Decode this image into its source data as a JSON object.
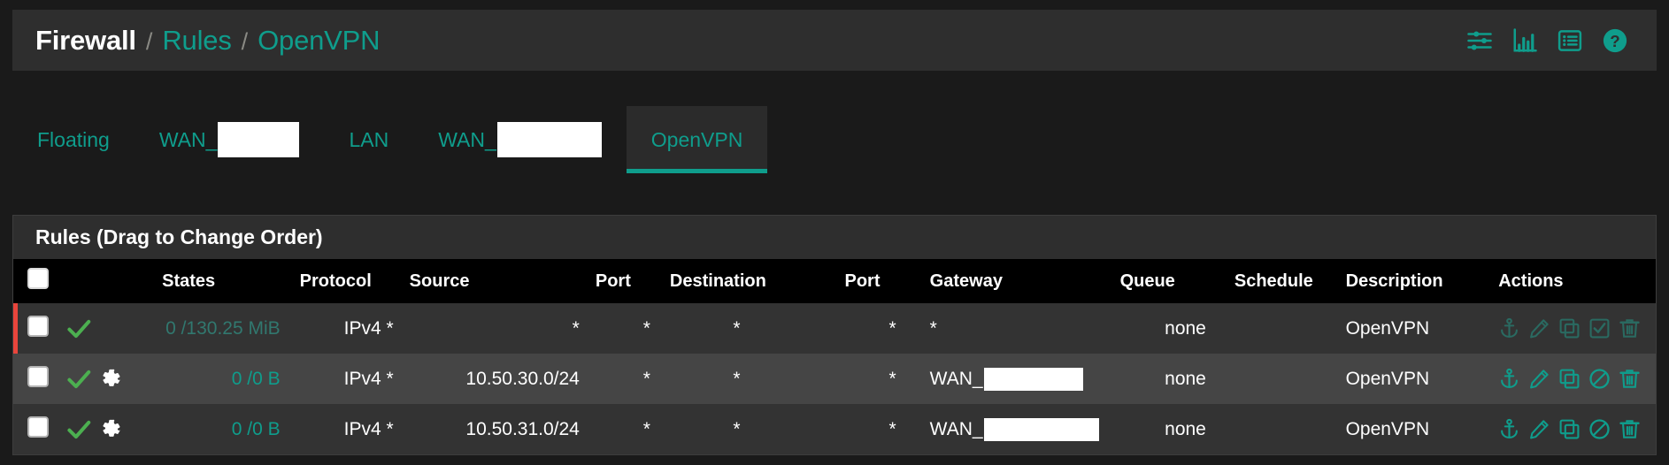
{
  "header": {
    "breadcrumb": {
      "root": "Firewall",
      "separator": "/",
      "level2": "Rules",
      "level3": "OpenVPN"
    },
    "icons": [
      {
        "name": "advanced-filter-icon",
        "title": "Advanced Filter"
      },
      {
        "name": "traffic-graph-icon",
        "title": "Traffic Graph"
      },
      {
        "name": "firewall-log-icon",
        "title": "Firewall Log"
      },
      {
        "name": "help-icon",
        "title": "Help"
      }
    ]
  },
  "tabs": [
    {
      "label": "Floating",
      "redacted": false,
      "active": false,
      "redact_width": 0
    },
    {
      "label": "WAN_",
      "redacted": true,
      "active": false,
      "redact_width": 92
    },
    {
      "label": "LAN",
      "redacted": false,
      "active": false,
      "redact_width": 0
    },
    {
      "label": "WAN_",
      "redacted": true,
      "active": false,
      "redact_width": 118
    },
    {
      "label": "OpenVPN",
      "redacted": false,
      "active": true,
      "redact_width": 0
    }
  ],
  "panel": {
    "title": "Rules (Drag to Change Order)"
  },
  "table": {
    "columns": [
      {
        "key": "select",
        "label": ""
      },
      {
        "key": "icons",
        "label": ""
      },
      {
        "key": "states",
        "label": "States"
      },
      {
        "key": "protocol",
        "label": "Protocol"
      },
      {
        "key": "source",
        "label": "Source"
      },
      {
        "key": "port_src",
        "label": "Port"
      },
      {
        "key": "destination",
        "label": "Destination"
      },
      {
        "key": "port_dst",
        "label": "Port"
      },
      {
        "key": "gateway",
        "label": "Gateway"
      },
      {
        "key": "queue",
        "label": "Queue"
      },
      {
        "key": "schedule",
        "label": "Schedule"
      },
      {
        "key": "description",
        "label": "Description"
      },
      {
        "key": "actions",
        "label": "Actions"
      }
    ],
    "rows": [
      {
        "selected": false,
        "status": "pass",
        "has_gear": false,
        "disabled": true,
        "marker": "red",
        "states": "0 /130.25 MiB",
        "protocol": "IPv4 *",
        "source": "*",
        "port_src": "*",
        "destination": "*",
        "port_dst": "*",
        "gateway": "*",
        "gateway_redacted": false,
        "gateway_redact_width": 0,
        "queue": "none",
        "schedule": "",
        "description": "OpenVPN",
        "toggle_action": "enable"
      },
      {
        "selected": false,
        "status": "pass",
        "has_gear": true,
        "disabled": false,
        "marker": "none",
        "states": "0 /0 B",
        "protocol": "IPv4 *",
        "source": "10.50.30.0/24",
        "port_src": "*",
        "destination": "*",
        "port_dst": "*",
        "gateway": "WAN_",
        "gateway_redacted": true,
        "gateway_redact_width": 112,
        "queue": "none",
        "schedule": "",
        "description": "OpenVPN",
        "toggle_action": "disable"
      },
      {
        "selected": false,
        "status": "pass",
        "has_gear": true,
        "disabled": false,
        "marker": "none",
        "states": "0 /0 B",
        "protocol": "IPv4 *",
        "source": "10.50.31.0/24",
        "port_src": "*",
        "destination": "*",
        "port_dst": "*",
        "gateway": "WAN_",
        "gateway_redacted": true,
        "gateway_redact_width": 130,
        "queue": "none",
        "schedule": "",
        "description": "OpenVPN",
        "toggle_action": "disable"
      }
    ],
    "action_icons": [
      {
        "name": "anchor-icon",
        "title": "Move"
      },
      {
        "name": "edit-pencil-icon",
        "title": "Edit"
      },
      {
        "name": "copy-icon",
        "title": "Copy"
      },
      {
        "name": "toggle-icon",
        "title": "Enable/Disable"
      },
      {
        "name": "delete-trash-icon",
        "title": "Delete"
      }
    ]
  },
  "colors": {
    "accent_teal": "#0f9d8c",
    "pass_green": "#4caf50",
    "marker_red": "#e8453c",
    "page_bg": "#1a1a1a",
    "panel_bg": "#2e2e2e",
    "row_odd": "#333333",
    "row_even": "#454545",
    "header_row_bg": "#000000"
  }
}
